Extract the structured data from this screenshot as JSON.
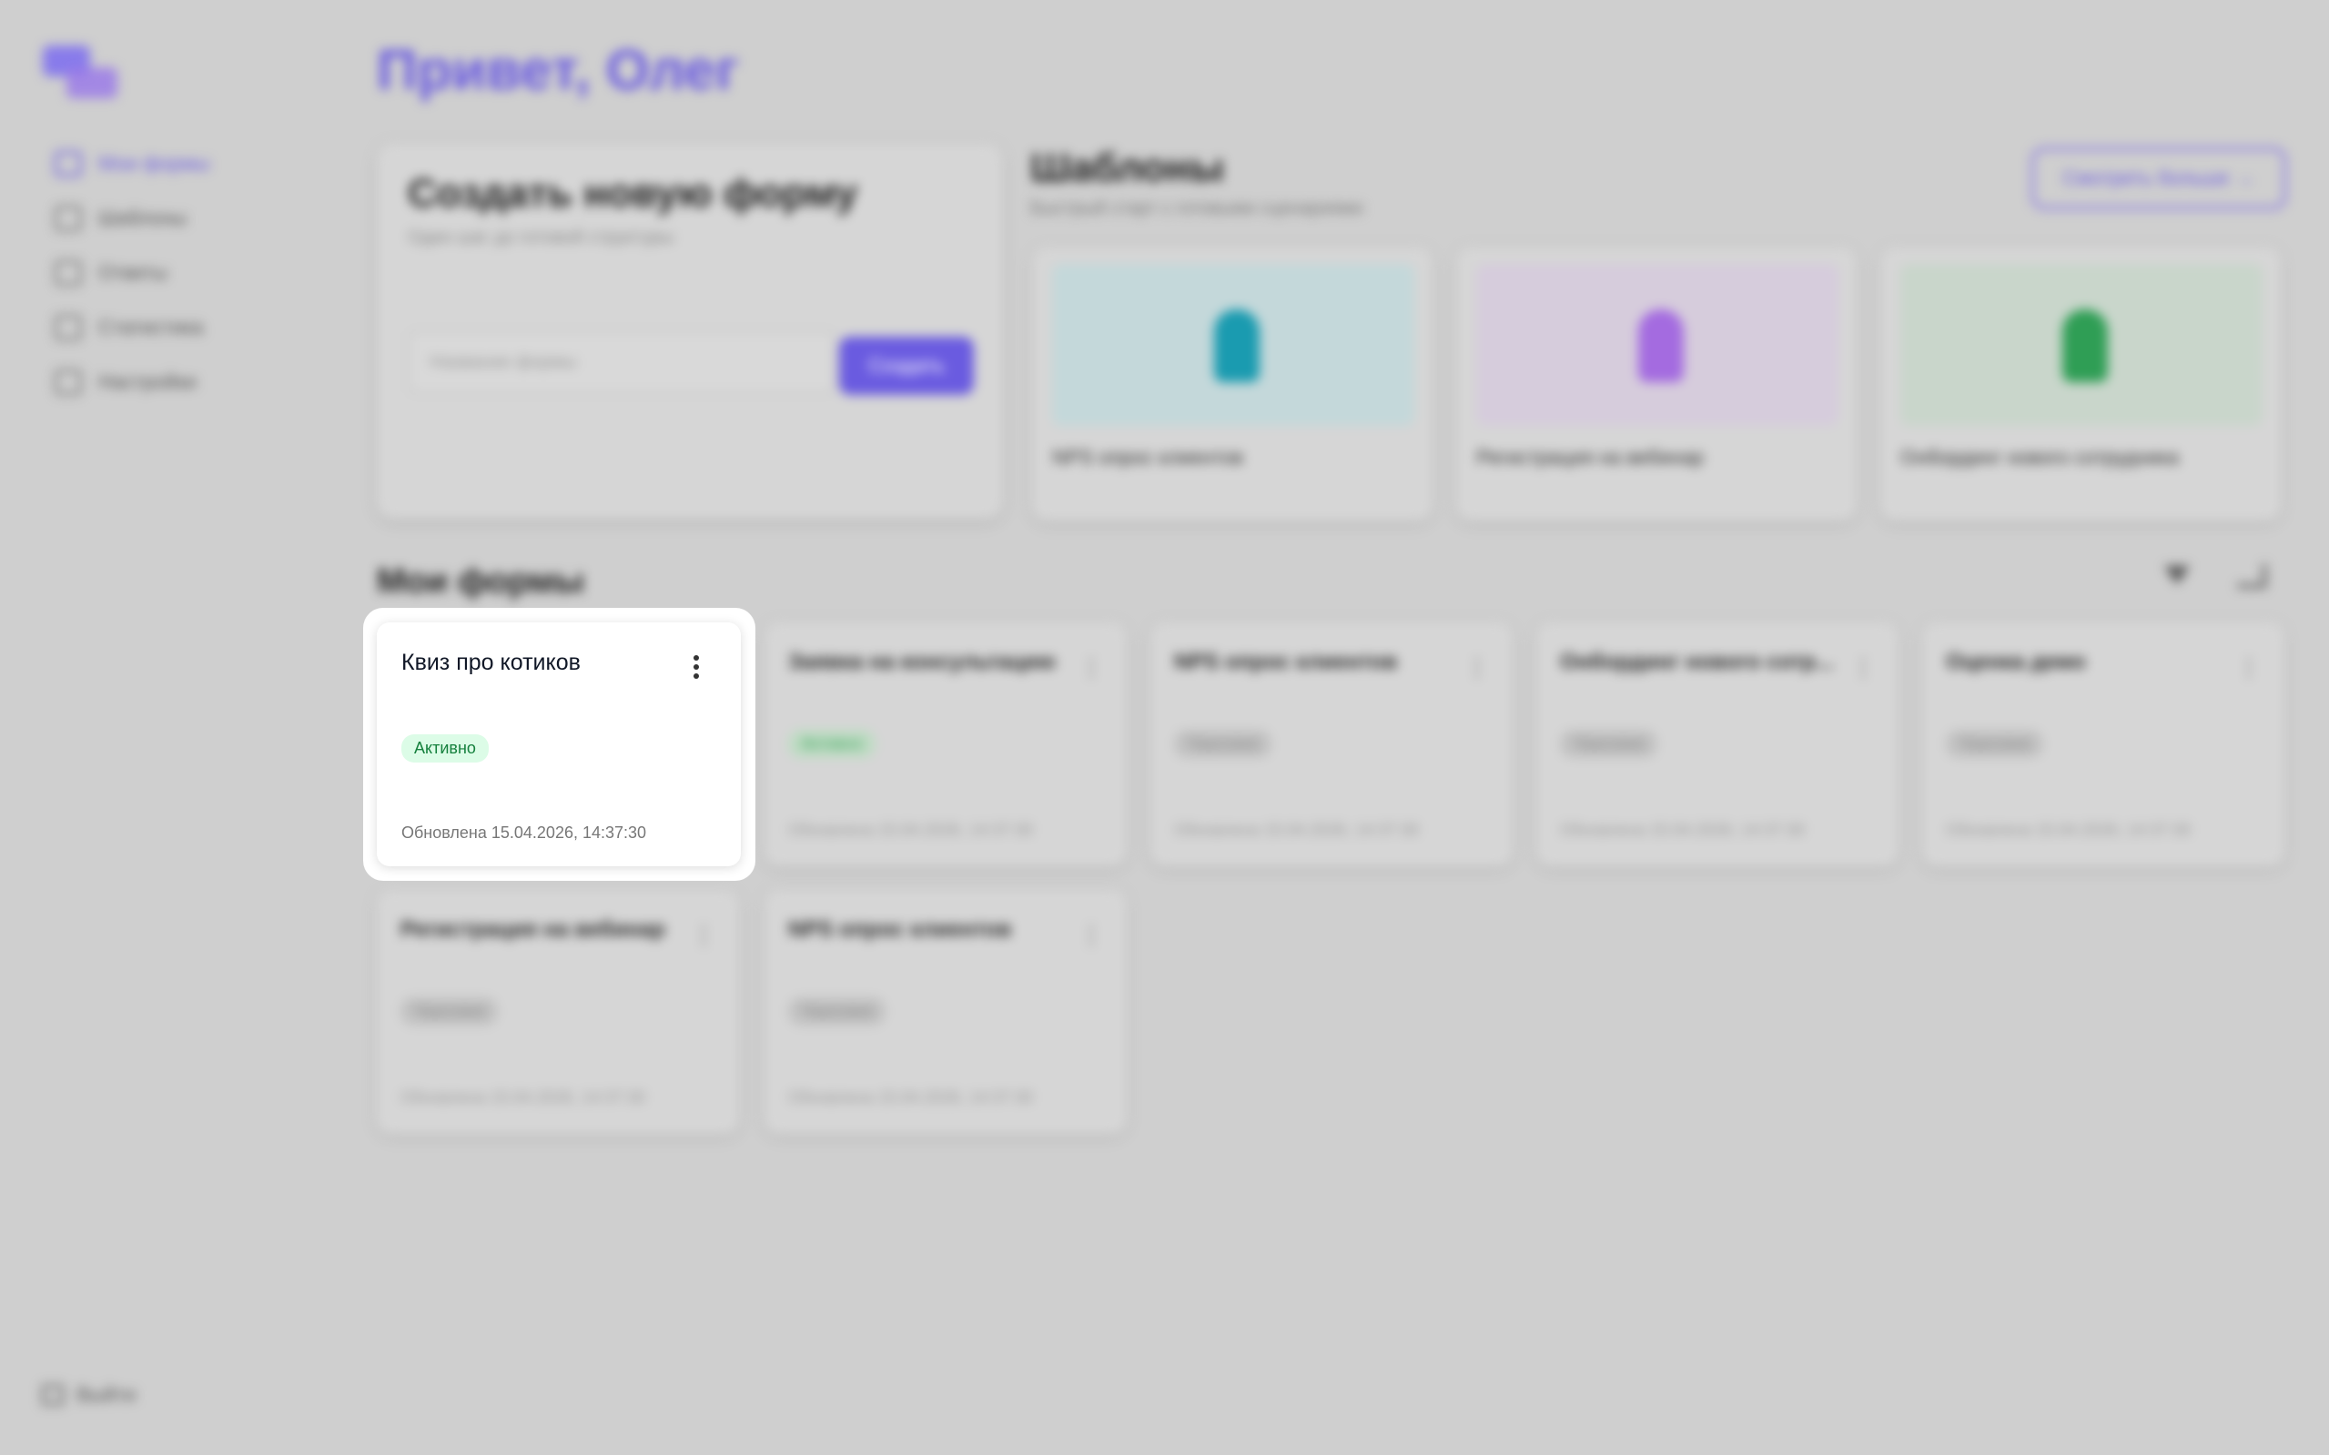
{
  "sidebar": {
    "items": [
      {
        "label": "Мои формы",
        "icon": "forms-icon"
      },
      {
        "label": "Шаблоны",
        "icon": "templates-icon"
      },
      {
        "label": "Ответы",
        "icon": "answers-icon"
      },
      {
        "label": "Статистика",
        "icon": "stats-icon"
      },
      {
        "label": "Настройки",
        "icon": "settings-icon"
      }
    ],
    "logout_label": "Выйти"
  },
  "header": {
    "greeting": "Привет, Олег"
  },
  "create": {
    "title": "Создать новую форму",
    "subtitle": "Один шаг до готовой структуры",
    "placeholder": "Название формы",
    "button_label": "Создать"
  },
  "templates": {
    "title": "Шаблоны",
    "subtitle": "Быстрый старт с готовыми сценариями",
    "more_label": "Смотреть больше →",
    "items": [
      {
        "name": "NPS опрос клиентов",
        "color": "#1a9bb0"
      },
      {
        "name": "Регистрация на вебинар",
        "color": "#a46be0"
      },
      {
        "name": "Онбординг нового сотрудника",
        "color": "#2f9e55"
      }
    ]
  },
  "forms": {
    "title": "Мои формы",
    "items": [
      {
        "title": "Квиз про котиков",
        "status": "Активно",
        "updated": "Обновлена 15.04.2026, 14:37:30"
      },
      {
        "title": "Заявка на консультацию",
        "status": "Активно",
        "updated": "Обновлена 15.04.2026, 14:37:30"
      },
      {
        "title": "NPS опрос клиентов",
        "status": "Черновик",
        "updated": "Обновлена 15.04.2026, 14:37:30"
      },
      {
        "title": "Онбординг нового сотр...",
        "status": "Черновик",
        "updated": "Обновлена 15.04.2026, 14:37:30"
      },
      {
        "title": "Оценка демо",
        "status": "Черновик",
        "updated": "Обновлена 15.04.2026, 14:37:30"
      },
      {
        "title": "Регистрация на вебинар",
        "status": "Черновик",
        "updated": "Обновлена 15.04.2026, 14:37:30"
      },
      {
        "title": "NPS опрос клиентов",
        "status": "Черновик",
        "updated": "Обновлена 15.04.2026, 14:37:30"
      }
    ]
  },
  "colors": {
    "accent": "#6a5be0",
    "active_badge_bg": "#dcfce7",
    "active_badge_text": "#15803d"
  }
}
